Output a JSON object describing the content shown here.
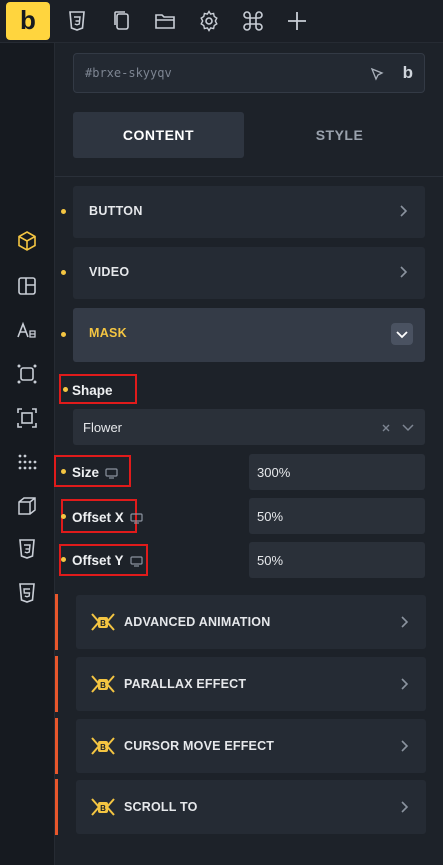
{
  "topbar": {
    "logo": "b",
    "icons": [
      "css3-icon",
      "pages-icon",
      "folder-icon",
      "gear-icon",
      "command-icon",
      "plus-icon"
    ]
  },
  "left_rail": {
    "icons": [
      "cube-icon",
      "layout-icon",
      "typography-icon",
      "dots-frame-icon",
      "crop-frame-icon",
      "grid-dots-icon",
      "box-3d-icon",
      "css3-icon",
      "html5-icon"
    ]
  },
  "panel": {
    "element_id": "#brxe-skyyqv",
    "tabs": {
      "content": "CONTENT",
      "style": "STYLE"
    },
    "sections": [
      {
        "label": "BUTTON"
      },
      {
        "label": "VIDEO"
      },
      {
        "label": "MASK"
      }
    ],
    "mask": {
      "shape_label": "Shape",
      "shape_value": "Flower",
      "size_label": "Size",
      "size_value": "300%",
      "offset_x_label": "Offset X",
      "offset_x_value": "50%",
      "offset_y_label": "Offset Y",
      "offset_y_value": "50%"
    },
    "advanced": [
      {
        "label": "ADVANCED ANIMATION"
      },
      {
        "label": "PARALLAX EFFECT"
      },
      {
        "label": "CURSOR MOVE EFFECT"
      },
      {
        "label": "SCROLL TO"
      }
    ]
  },
  "colors": {
    "accent": "#ffd53e",
    "highlight_red": "#e01b1b",
    "addon_bar": "#e8572c"
  }
}
